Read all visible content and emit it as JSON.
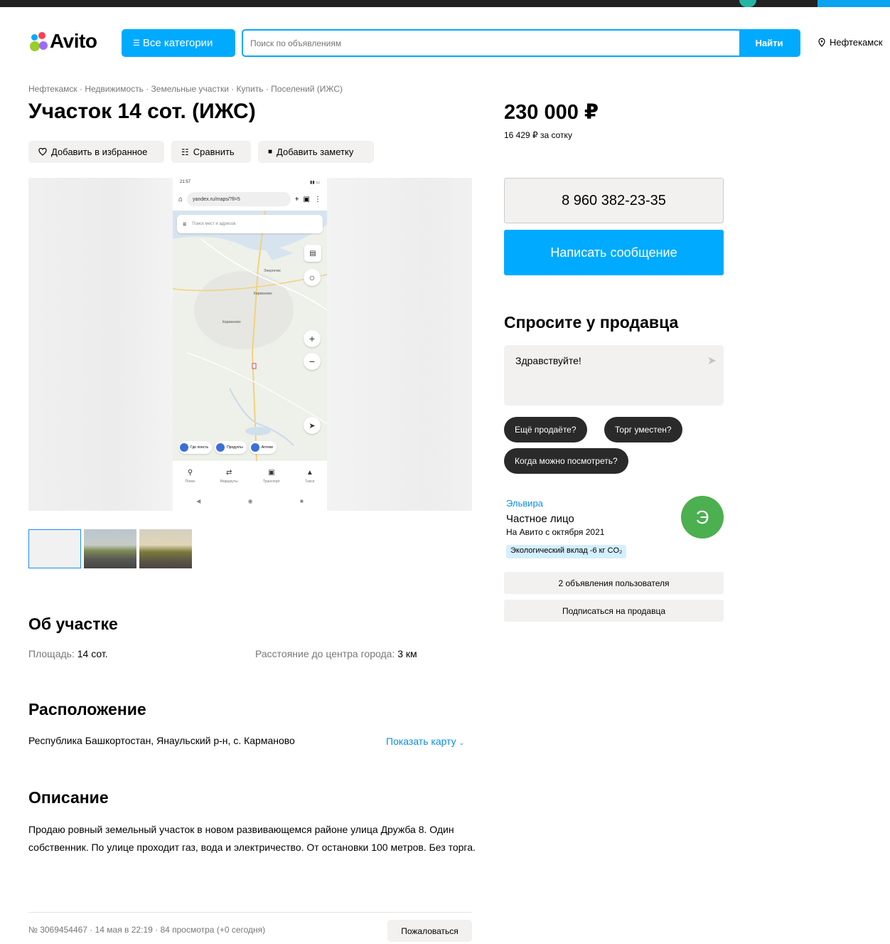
{
  "header": {
    "logo": "Avito",
    "categories_label": "Все категории",
    "search_placeholder": "Поиск по объявлениям",
    "search_button": "Найти",
    "location": "Нефтекамск",
    "brand_colors": [
      "#00aaff",
      "#97cf26",
      "#ff4053",
      "#a169f7"
    ]
  },
  "breadcrumb": "Нефтекамск · Недвижимость · Земельные участки · Купить · Поселений (ИЖС)",
  "title": "Участок 14 сот. (ИЖС)",
  "actions": {
    "favorite": "Добавить в избранное",
    "compare": "Сравнить",
    "note": "Добавить заметку"
  },
  "gallery": {
    "phone_time": "21:57",
    "url": "yandex.ru/maps/?ll=5",
    "map_search": "Поиск мест и адресов",
    "map_labels": [
      "Энергетик",
      "Карманово",
      "Карманово"
    ],
    "chips": [
      "Где поесть",
      "Продукты",
      "Аптеки"
    ],
    "tabs": [
      "Поиск",
      "Маршруты",
      "Транспорт",
      "Такси"
    ],
    "thumbnail_count": 3
  },
  "about": {
    "heading": "Об участке",
    "area_label": "Площадь:",
    "area_value": "14 сот.",
    "distance_label": "Расстояние до центра города:",
    "distance_value": "3 км"
  },
  "location_section": {
    "heading": "Расположение",
    "address": "Республика Башкортостан, Янаульский р-н, с. Карманово",
    "show_map": "Показать карту"
  },
  "description": {
    "heading": "Описание",
    "text": "Продаю ровный земельный участок в новом развивающемся районе улица Дружба 8. Один собственник. По улице проходит газ, вода и электричество. От остановки 100 метров. Без торга."
  },
  "footer": {
    "meta": "№ 3069454467 · 14 мая в 22:19 · 84 просмотра (+0 сегодня)",
    "complain": "Пожаловаться"
  },
  "sidebar": {
    "price": "230 000 ₽",
    "price_per": "16 429 ₽ за сотку",
    "phone": "8 960 382-23-35",
    "message_button": "Написать сообщение",
    "ask_heading": "Спросите у продавца",
    "ask_text": "Здравствуйте!",
    "quick_questions": [
      "Ещё продаёте?",
      "Торг уместен?",
      "Когда можно посмотреть?"
    ],
    "seller": {
      "name": "Эльвира",
      "type": "Частное лицо",
      "since": "На Авито с октября 2021",
      "eco": "Экологический вклад -6 кг CO₂",
      "avatar_letter": "Э",
      "avatar_color": "#4caf50"
    },
    "listings_button": "2 объявления пользователя",
    "subscribe_button": "Подписаться на продавца"
  }
}
